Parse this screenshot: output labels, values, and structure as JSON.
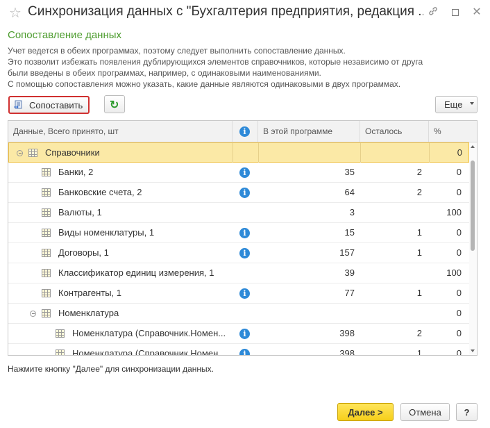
{
  "window": {
    "title": "Синхронизация данных с \"Бухгалтерия предприятия, редакция ...",
    "star_icon": "star-icon",
    "link_icon": "link-icon",
    "maximize_icon": "maximize-icon",
    "close_icon": "close-icon"
  },
  "section": {
    "title": "Сопоставление данных",
    "description": [
      "Учет ведется в обеих программах, поэтому следует выполнить сопоставление данных.",
      "Это позволит избежать появления дублирующихся элементов справочников, которые независимо от друга",
      "были введены в обеих программах, например, с одинаковыми наименованиями.",
      "С помощью сопоставления можно указать, какие данные являются одинаковыми в двух программах."
    ]
  },
  "toolbar": {
    "match_label": "Сопоставить",
    "refresh_icon": "refresh-icon",
    "more_label": "Еще"
  },
  "grid": {
    "headers": {
      "data": "Данные, Всего принято, шт",
      "info": "i",
      "in_program": "В этой программе",
      "remaining": "Осталось",
      "percent": "%"
    },
    "rows": [
      {
        "level": 0,
        "toggle": true,
        "label": "Справочники",
        "info": false,
        "in_program": "",
        "remaining": "",
        "percent": "0",
        "selected": true
      },
      {
        "level": 1,
        "toggle": false,
        "label": "Банки, 2",
        "info": true,
        "in_program": "35",
        "remaining": "2",
        "percent": "0",
        "selected": false
      },
      {
        "level": 1,
        "toggle": false,
        "label": "Банковские счета, 2",
        "info": true,
        "in_program": "64",
        "remaining": "2",
        "percent": "0",
        "selected": false
      },
      {
        "level": 1,
        "toggle": false,
        "label": "Валюты, 1",
        "info": false,
        "in_program": "3",
        "remaining": "",
        "percent": "100",
        "selected": false
      },
      {
        "level": 1,
        "toggle": false,
        "label": "Виды номенклатуры, 1",
        "info": true,
        "in_program": "15",
        "remaining": "1",
        "percent": "0",
        "selected": false
      },
      {
        "level": 1,
        "toggle": false,
        "label": "Договоры, 1",
        "info": true,
        "in_program": "157",
        "remaining": "1",
        "percent": "0",
        "selected": false
      },
      {
        "level": 1,
        "toggle": false,
        "label": "Классификатор единиц измерения, 1",
        "info": false,
        "in_program": "39",
        "remaining": "",
        "percent": "100",
        "selected": false
      },
      {
        "level": 1,
        "toggle": false,
        "label": "Контрагенты, 1",
        "info": true,
        "in_program": "77",
        "remaining": "1",
        "percent": "0",
        "selected": false
      },
      {
        "level": 1,
        "toggle": true,
        "label": "Номенклатура",
        "info": false,
        "in_program": "",
        "remaining": "",
        "percent": "0",
        "selected": false
      },
      {
        "level": 2,
        "toggle": false,
        "label": "Номенклатура (Справочник.Номен...",
        "info": true,
        "in_program": "398",
        "remaining": "2",
        "percent": "0",
        "selected": false
      },
      {
        "level": 2,
        "toggle": false,
        "label": "Номенклатура (Справочник.Номен...",
        "info": true,
        "in_program": "398",
        "remaining": "1",
        "percent": "0",
        "selected": false
      }
    ]
  },
  "footer": {
    "hint": "Нажмите кнопку \"Далее\" для синхронизации данных.",
    "next_label": "Далее >",
    "cancel_label": "Отмена",
    "help_label": "?"
  },
  "colors": {
    "section_title": "#4b9b2c",
    "selected_row": "#fbe9a6",
    "primary_button": "#f6cf1a",
    "highlight_border": "#d03030",
    "info_icon": "#2e8ad8"
  }
}
